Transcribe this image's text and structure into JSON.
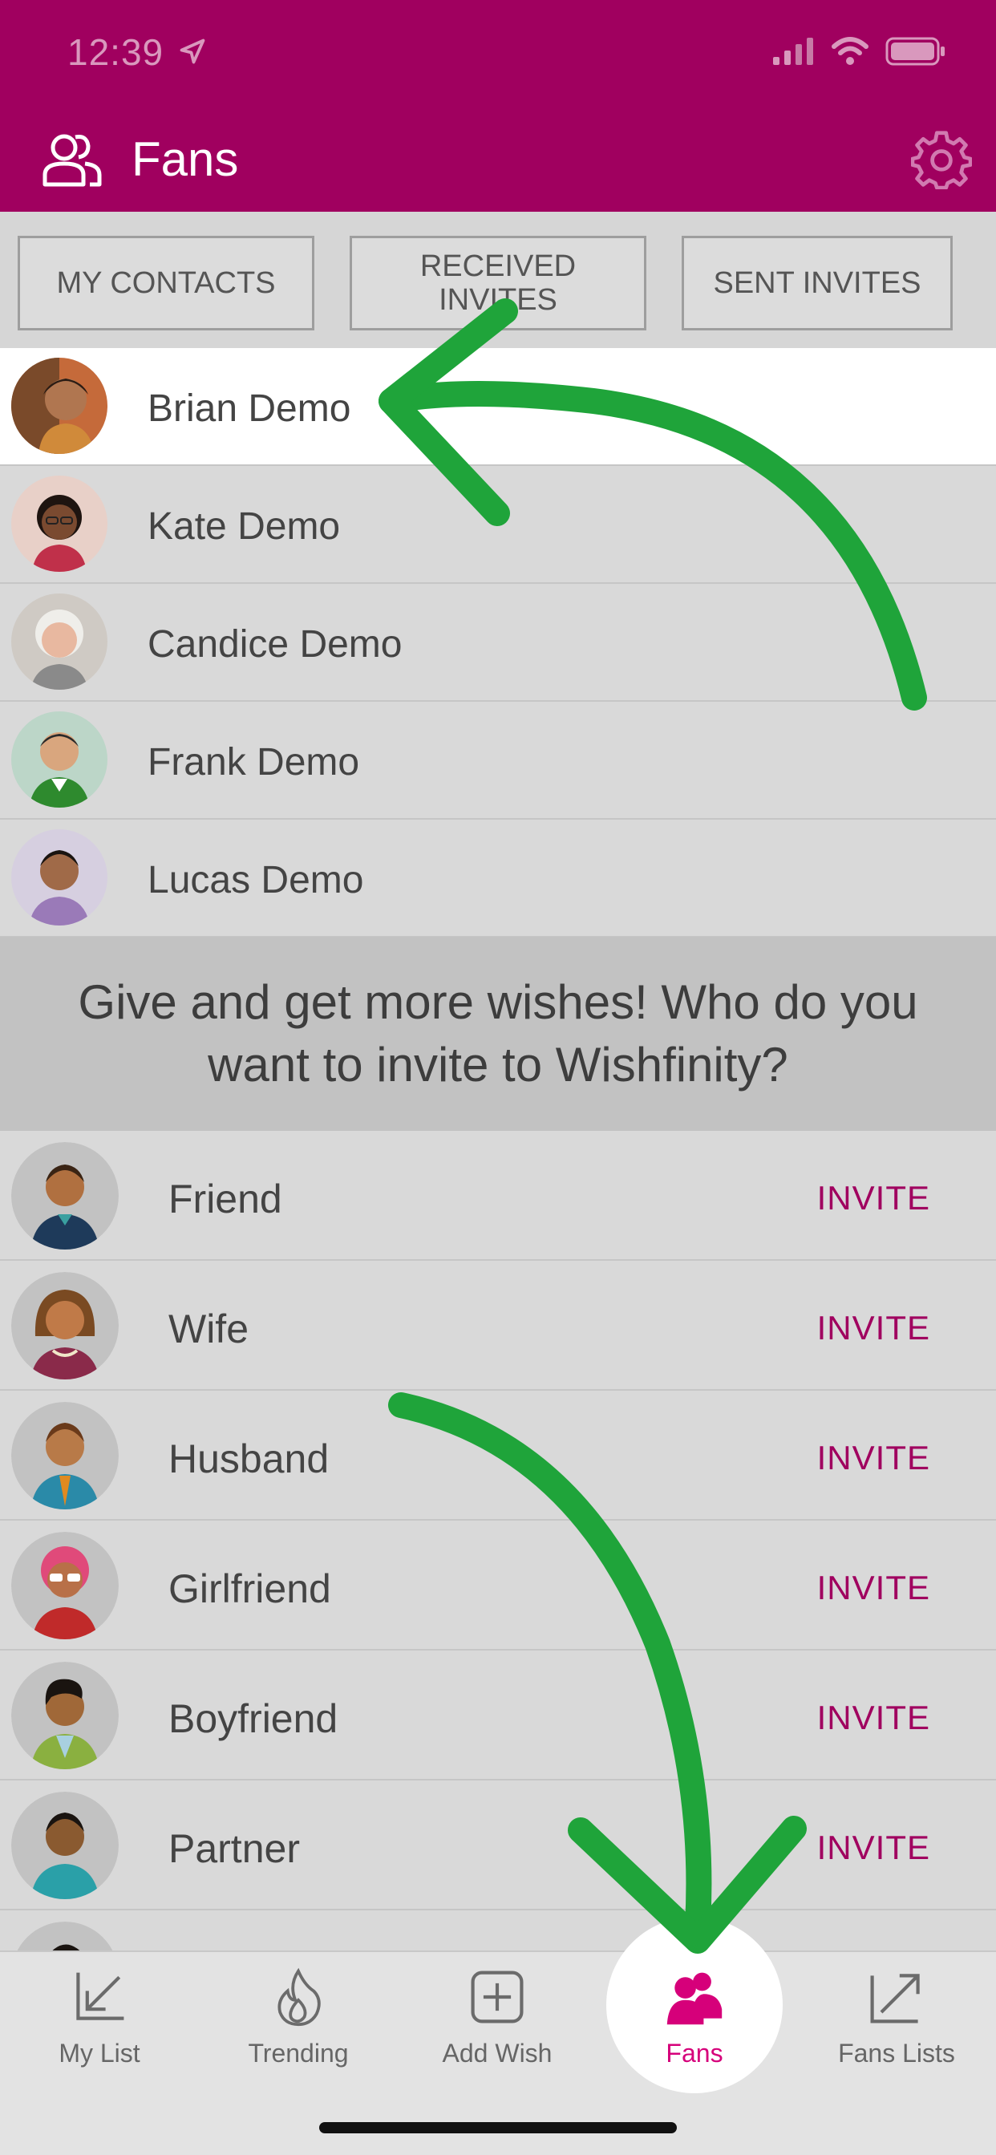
{
  "status": {
    "time": "12:39"
  },
  "header": {
    "title": "Fans"
  },
  "tabs": [
    {
      "label": "MY CONTACTS"
    },
    {
      "label": "RECEIVED INVITES"
    },
    {
      "label": "SENT INVITES"
    }
  ],
  "contacts": [
    {
      "name": "Brian Demo"
    },
    {
      "name": "Kate Demo"
    },
    {
      "name": "Candice Demo"
    },
    {
      "name": "Frank Demo"
    },
    {
      "name": "Lucas Demo"
    }
  ],
  "prompt": "Give and get more wishes! Who do you want to invite to Wishfinity?",
  "invite_rows": [
    {
      "label": "Friend",
      "action": "INVITE"
    },
    {
      "label": "Wife",
      "action": "INVITE"
    },
    {
      "label": "Husband",
      "action": "INVITE"
    },
    {
      "label": "Girlfriend",
      "action": "INVITE"
    },
    {
      "label": "Boyfriend",
      "action": "INVITE"
    },
    {
      "label": "Partner",
      "action": "INVITE"
    }
  ],
  "nav": [
    {
      "label": "My List",
      "icon": "arrow-down-left-icon"
    },
    {
      "label": "Trending",
      "icon": "flame-icon"
    },
    {
      "label": "Add Wish",
      "icon": "plus-square-icon"
    },
    {
      "label": "Fans",
      "icon": "users-icon"
    },
    {
      "label": "Fans Lists",
      "icon": "arrow-up-right-icon"
    }
  ],
  "colors": {
    "brand": "#a0005f",
    "active_nav": "#d6007a",
    "arrow": "#1fa43a"
  }
}
